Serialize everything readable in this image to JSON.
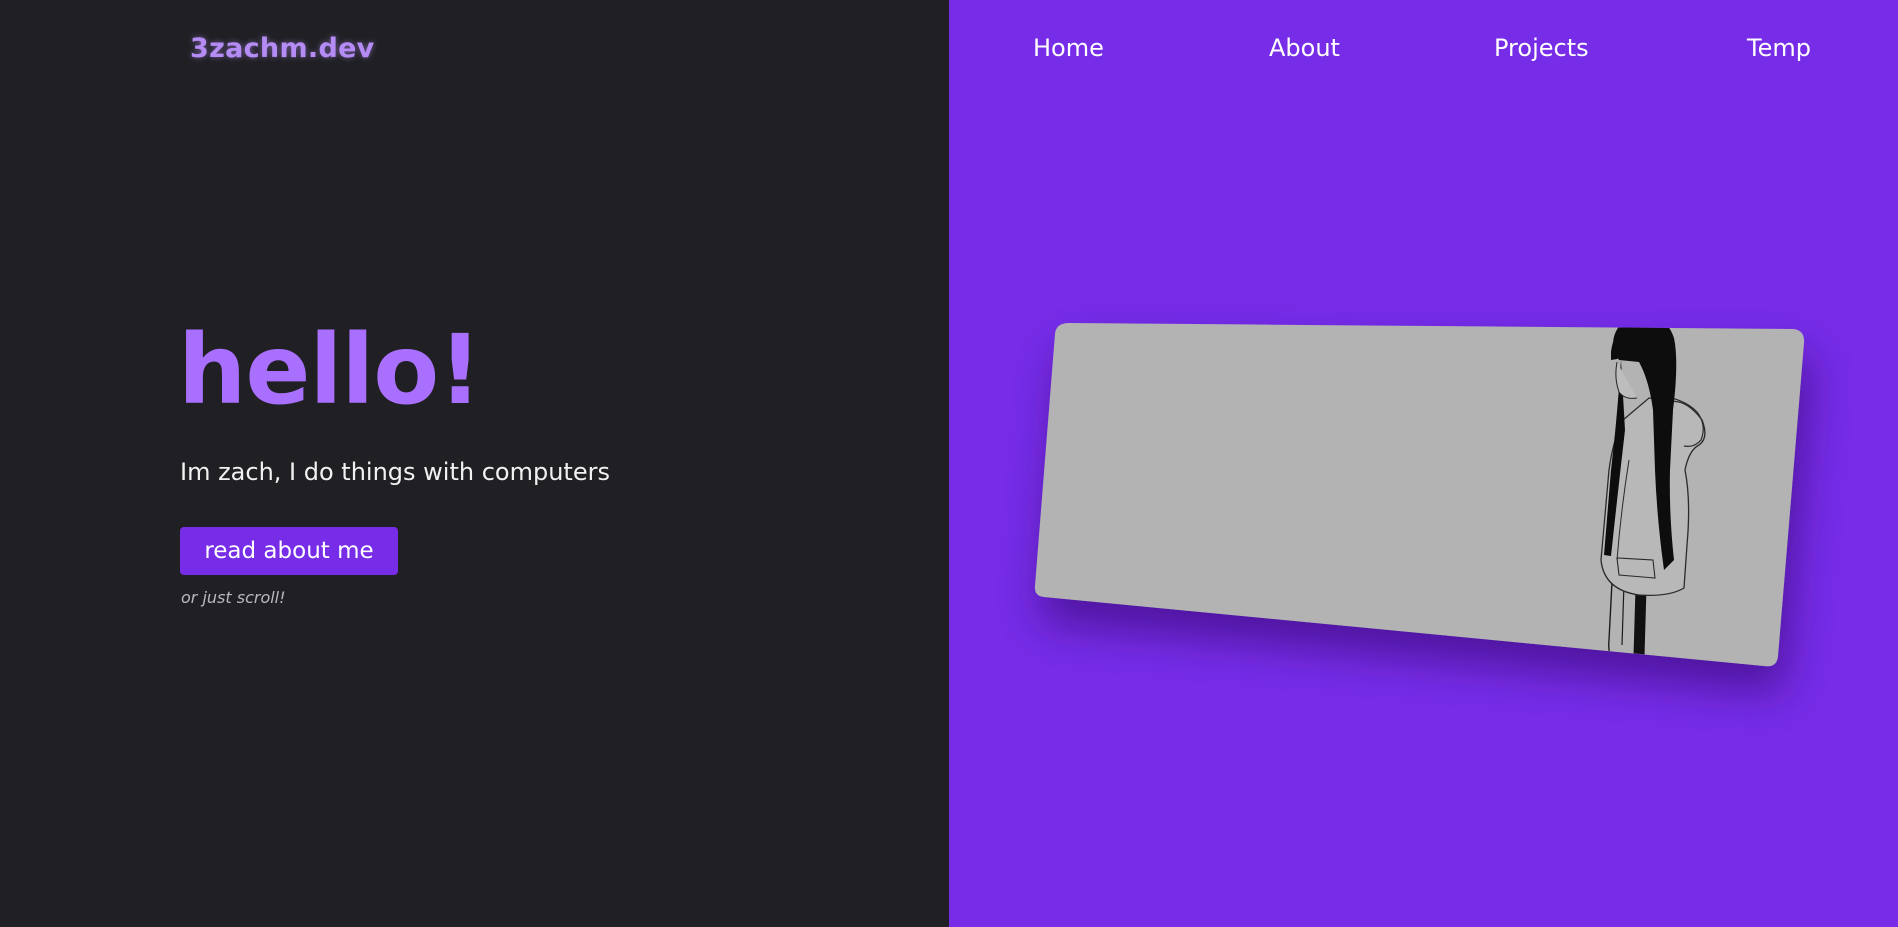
{
  "header": {
    "logo": "3zachm.dev"
  },
  "nav": {
    "items": [
      {
        "label": "Home"
      },
      {
        "label": "About"
      },
      {
        "label": "Projects"
      },
      {
        "label": "Temp"
      }
    ]
  },
  "hero": {
    "title": "hello!",
    "subtitle": "Im zach, I do things with computers",
    "button_label": "read about me",
    "hint": "or just scroll!"
  },
  "colors": {
    "left_background": "#202024",
    "right_background": "#772ce8",
    "accent": "#a970ff",
    "card": "#b3b3b3"
  },
  "image": {
    "icon": "anime-girl-illustration"
  }
}
